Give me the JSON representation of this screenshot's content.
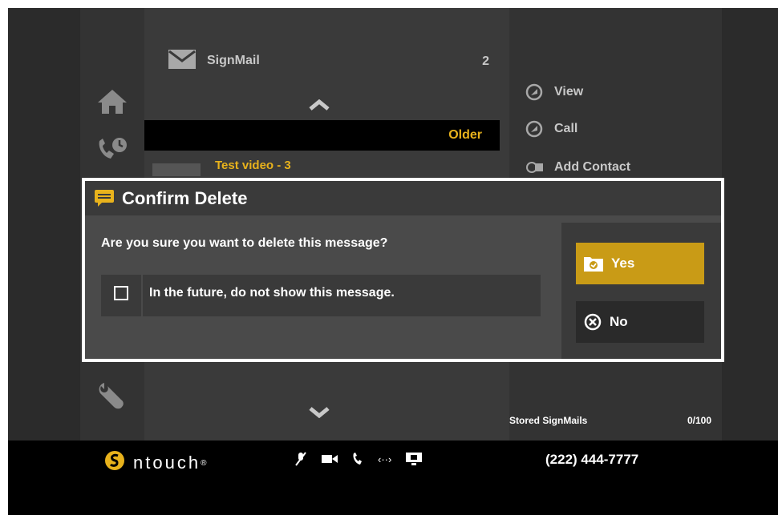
{
  "list": {
    "header_label": "SignMail",
    "header_count": "2",
    "older_label": "Older",
    "item_title": "Test video - 3"
  },
  "actions": {
    "view": "View",
    "call": "Call",
    "add_contact": "Add Contact"
  },
  "storage": {
    "label": "Stored SignMails",
    "count": "0/100"
  },
  "status_bar": {
    "brand": "ntouch",
    "brand_mark": "®",
    "video_protocol_glyph": "‹··›",
    "phone_number": "(222) 444-7777"
  },
  "dialog": {
    "title": "Confirm Delete",
    "question": "Are you sure you want to delete this message?",
    "option_label": "In the future, do not show this message.",
    "option_checked": false,
    "yes_label": "Yes",
    "no_label": "No"
  },
  "colors": {
    "accent": "#e8b21c",
    "yes_button": "#c99b16"
  },
  "icons": [
    "home-icon",
    "call-history-icon",
    "wrench-icon",
    "mail-icon",
    "chevron-up-icon",
    "chevron-down-icon",
    "arrow-circle-icon",
    "add-contact-icon",
    "message-icon",
    "folder-check-icon",
    "close-circle-icon",
    "ntouch-logo-icon",
    "mic-muted-icon",
    "video-camera-icon",
    "phone-icon",
    "monitor-icon"
  ]
}
